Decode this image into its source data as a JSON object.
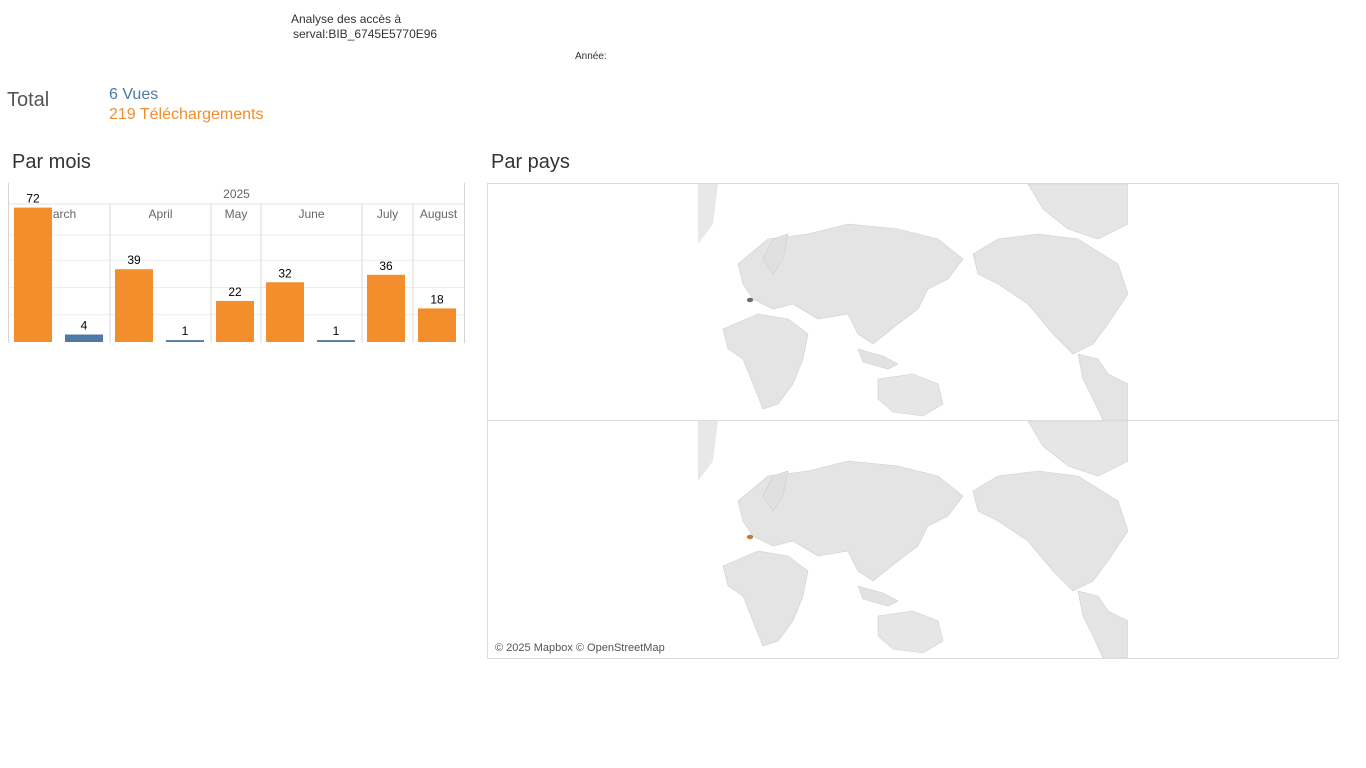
{
  "header": {
    "title_line1": "Analyse des accès à",
    "title_line2": "serval:BIB_6745E5770E96",
    "year_label": "Année:"
  },
  "totals": {
    "label": "Total",
    "views": "6 Vues",
    "downloads": "219 Téléchargements"
  },
  "sections": {
    "by_month": "Par mois",
    "by_country": "Par pays"
  },
  "colors": {
    "views": "#4e79a7",
    "downloads": "#f28e2b"
  },
  "chart_data": {
    "type": "bar",
    "year": "2025",
    "categories": [
      "March",
      "April",
      "May",
      "June",
      "July",
      "August"
    ],
    "series": [
      {
        "name": "Téléchargements",
        "values": [
          72,
          39,
          22,
          32,
          36,
          18
        ]
      },
      {
        "name": "Vues",
        "values": [
          4,
          1,
          null,
          1,
          null,
          null
        ]
      }
    ],
    "ylim": [
      0,
      80
    ],
    "grid": true
  },
  "map": {
    "credit": "© 2025 Mapbox © OpenStreetMap",
    "highlight_color_top": "#6b6b6b",
    "highlight_color_bottom": "#c07a3a"
  }
}
